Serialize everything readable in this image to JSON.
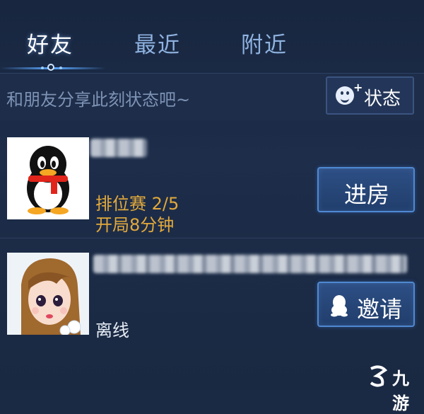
{
  "tabs": [
    {
      "label": "好友",
      "active": true
    },
    {
      "label": "最近",
      "active": false
    },
    {
      "label": "附近",
      "active": false
    }
  ],
  "status": {
    "placeholder": "和朋友分享此刻状态吧~",
    "button_label": "状态",
    "button_icon": "smiley-plus-icon"
  },
  "friends": [
    {
      "avatar": "qq-penguin-avatar",
      "name_blurred": true,
      "game_mode": "排位赛 2/5",
      "game_time": "开局8分钟",
      "action_label": "进房"
    },
    {
      "avatar": "cartoon-girl-avatar",
      "name_blurred": true,
      "presence": "离线",
      "action_label": "邀请",
      "action_icon": "qq-penguin-icon"
    }
  ],
  "watermark": {
    "text": "九游"
  },
  "colors": {
    "background": "#1b2a44",
    "accent_gold": "#e2a93b",
    "button_border": "#4f89d2",
    "tab_inactive": "#8fb3e0"
  }
}
